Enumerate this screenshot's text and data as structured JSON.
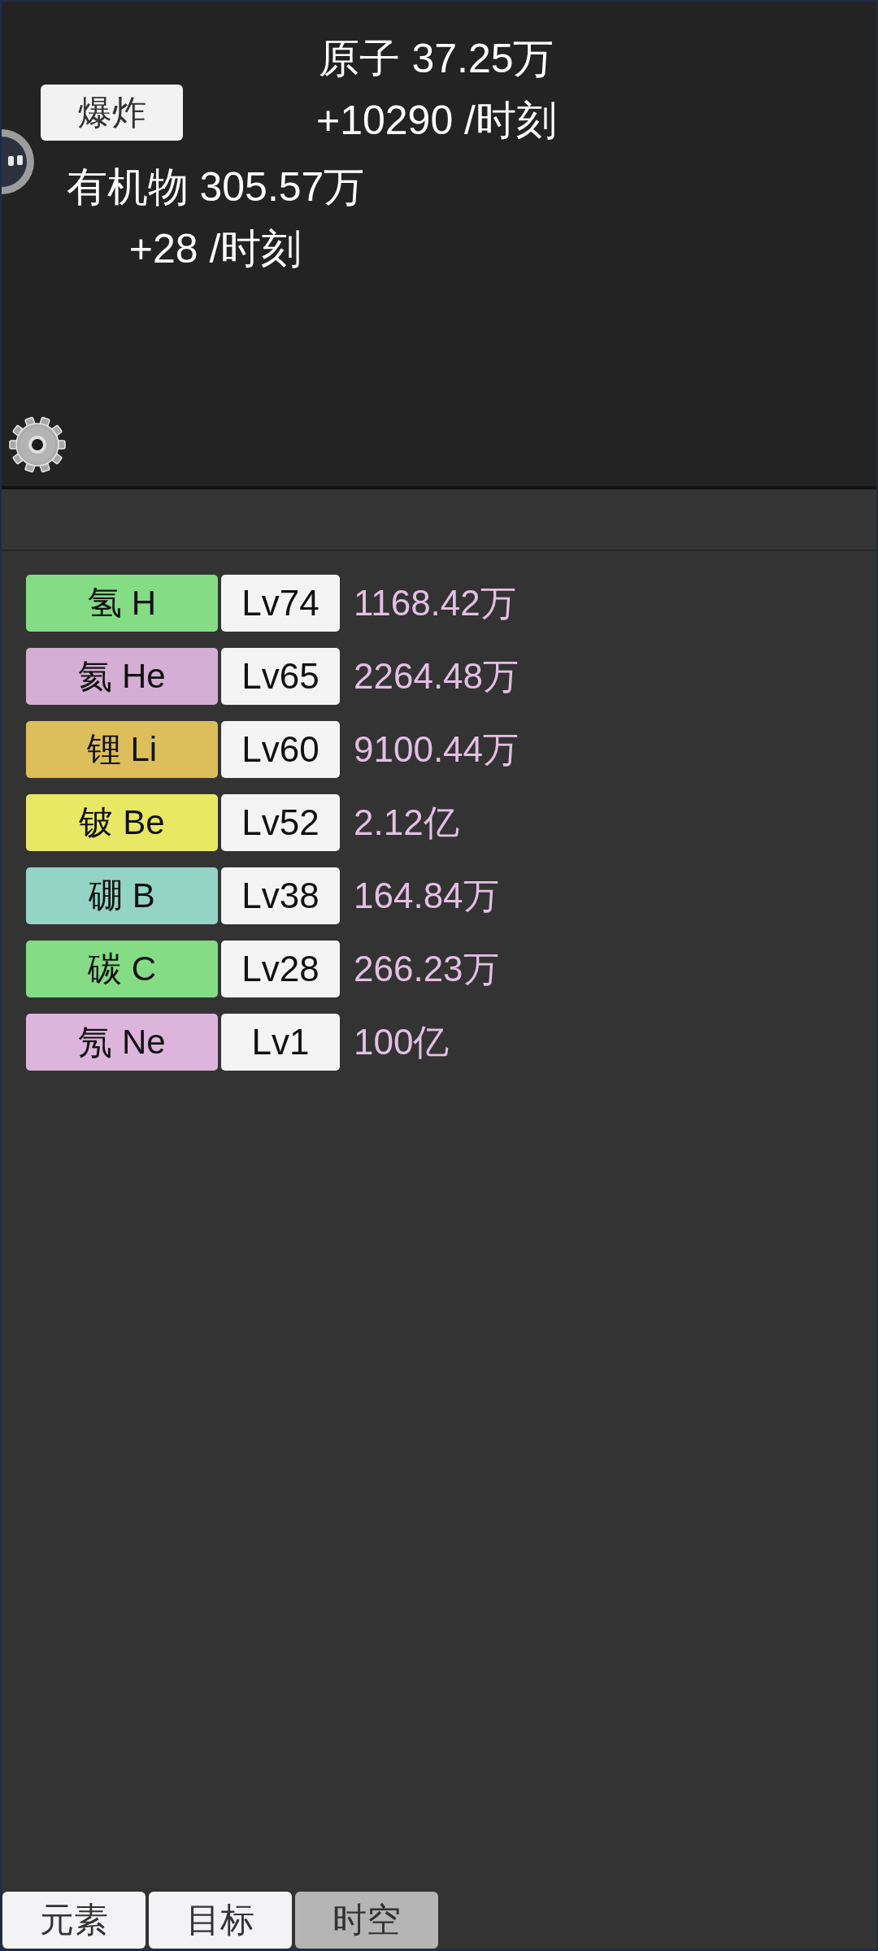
{
  "header": {
    "explode_button": "爆炸",
    "atoms": {
      "label": "原子 37.25万",
      "rate": "+10290 /时刻"
    },
    "organics": {
      "label": "有机物 305.57万",
      "rate": "+28 /时刻"
    }
  },
  "elements": [
    {
      "name": "氢 H",
      "level_text": "Lv74",
      "amount": "1168.42万",
      "color": "#84dc84"
    },
    {
      "name": "氦 He",
      "level_text": "Lv65",
      "amount": "2264.48万",
      "color": "#d4aed4"
    },
    {
      "name": "锂 Li",
      "level_text": "Lv60",
      "amount": "9100.44万",
      "color": "#dcbe5a"
    },
    {
      "name": "铍 Be",
      "level_text": "Lv52",
      "amount": "2.12亿",
      "color": "#e8e864"
    },
    {
      "name": "硼 B",
      "level_text": "Lv38",
      "amount": "164.84万",
      "color": "#94d4c4"
    },
    {
      "name": "碳 C",
      "level_text": "Lv28",
      "amount": "266.23万",
      "color": "#84dc84"
    },
    {
      "name": "氖 Ne",
      "level_text": "Lv1",
      "amount": "100亿",
      "color": "#dcb4dc"
    }
  ],
  "tabs": [
    {
      "label": "元素",
      "selected": false
    },
    {
      "label": "目标",
      "selected": false
    },
    {
      "label": "时空",
      "selected": true
    }
  ]
}
